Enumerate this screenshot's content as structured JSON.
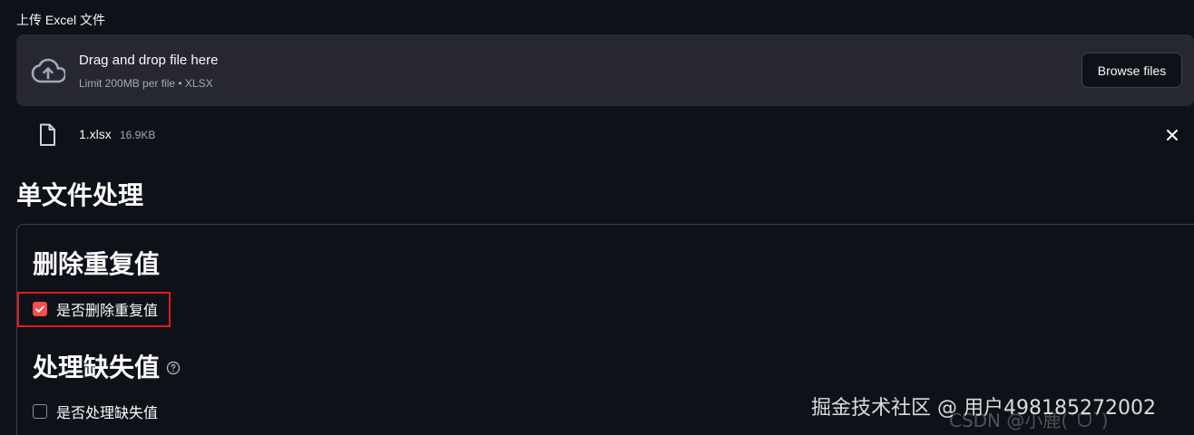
{
  "uploader": {
    "label": "上传 Excel 文件",
    "drop_title": "Drag and drop file here",
    "drop_subtitle": "Limit 200MB per file • XLSX",
    "browse_label": "Browse files"
  },
  "uploaded_file": {
    "name": "1.xlsx",
    "size": "16.9KB"
  },
  "page": {
    "section_title": "单文件处理"
  },
  "panel": {
    "dedup_title": "删除重复值",
    "dedup_checkbox_label": "是否删除重复值",
    "dedup_checked": true,
    "missing_title": "处理缺失值",
    "missing_checkbox_label": "是否处理缺失值",
    "missing_checked": false
  },
  "watermark": {
    "text": "掘金技术社区 @ 用户498185272002",
    "text2": "CSDN @小鹿(ˊᗜˋ)"
  },
  "colors": {
    "background": "#0e1117",
    "dropzone": "#262730",
    "accent": "#ff4b4b",
    "highlight": "#e01b1b"
  },
  "icons": {
    "upload": "cloud-upload-icon",
    "file": "file-icon",
    "close": "close-icon",
    "help": "help-circle-icon",
    "check": "check-icon"
  }
}
